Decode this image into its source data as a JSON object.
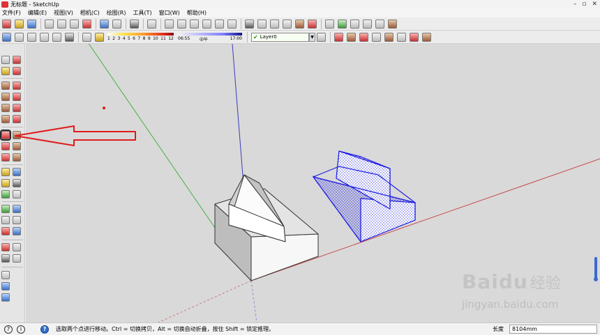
{
  "window": {
    "title": "无标题 - SketchUp",
    "controls": {
      "minimize": "–",
      "maximize": "▫",
      "close": "✕"
    }
  },
  "menu": {
    "items": [
      {
        "label": "文件(F)"
      },
      {
        "label": "编辑(E)"
      },
      {
        "label": "视图(V)"
      },
      {
        "label": "相机(C)"
      },
      {
        "label": "绘图(R)"
      },
      {
        "label": "工具(T)"
      },
      {
        "label": "窗口(W)"
      },
      {
        "label": "帮助(H)"
      }
    ]
  },
  "shadow_ramp": {
    "labels": [
      "1",
      "2",
      "3",
      "4",
      "5",
      "6",
      "7",
      "8",
      "9",
      "10",
      "11",
      "12"
    ]
  },
  "time_ramp": {
    "start": "06:55",
    "mid": "中午",
    "end": "17:00"
  },
  "layers": {
    "current": "Layer0"
  },
  "status": {
    "message": "选取两个点进行移动。Ctrl = 切换拷贝，Alt = 切换自动折叠，按住 Shift = 锁定推理。",
    "length_label": "长度",
    "length_value": "8104mm"
  },
  "watermark": {
    "brand": "Bai",
    "brand2": "du",
    "cn": "经验",
    "url": "jingyan.baidu.com"
  },
  "colors": {
    "red_axis": "#c84a4a",
    "green_axis": "#46b046",
    "blue_axis": "#3a3ab8",
    "selection": "#1e1ee6",
    "annotation": "#e01a1a"
  }
}
